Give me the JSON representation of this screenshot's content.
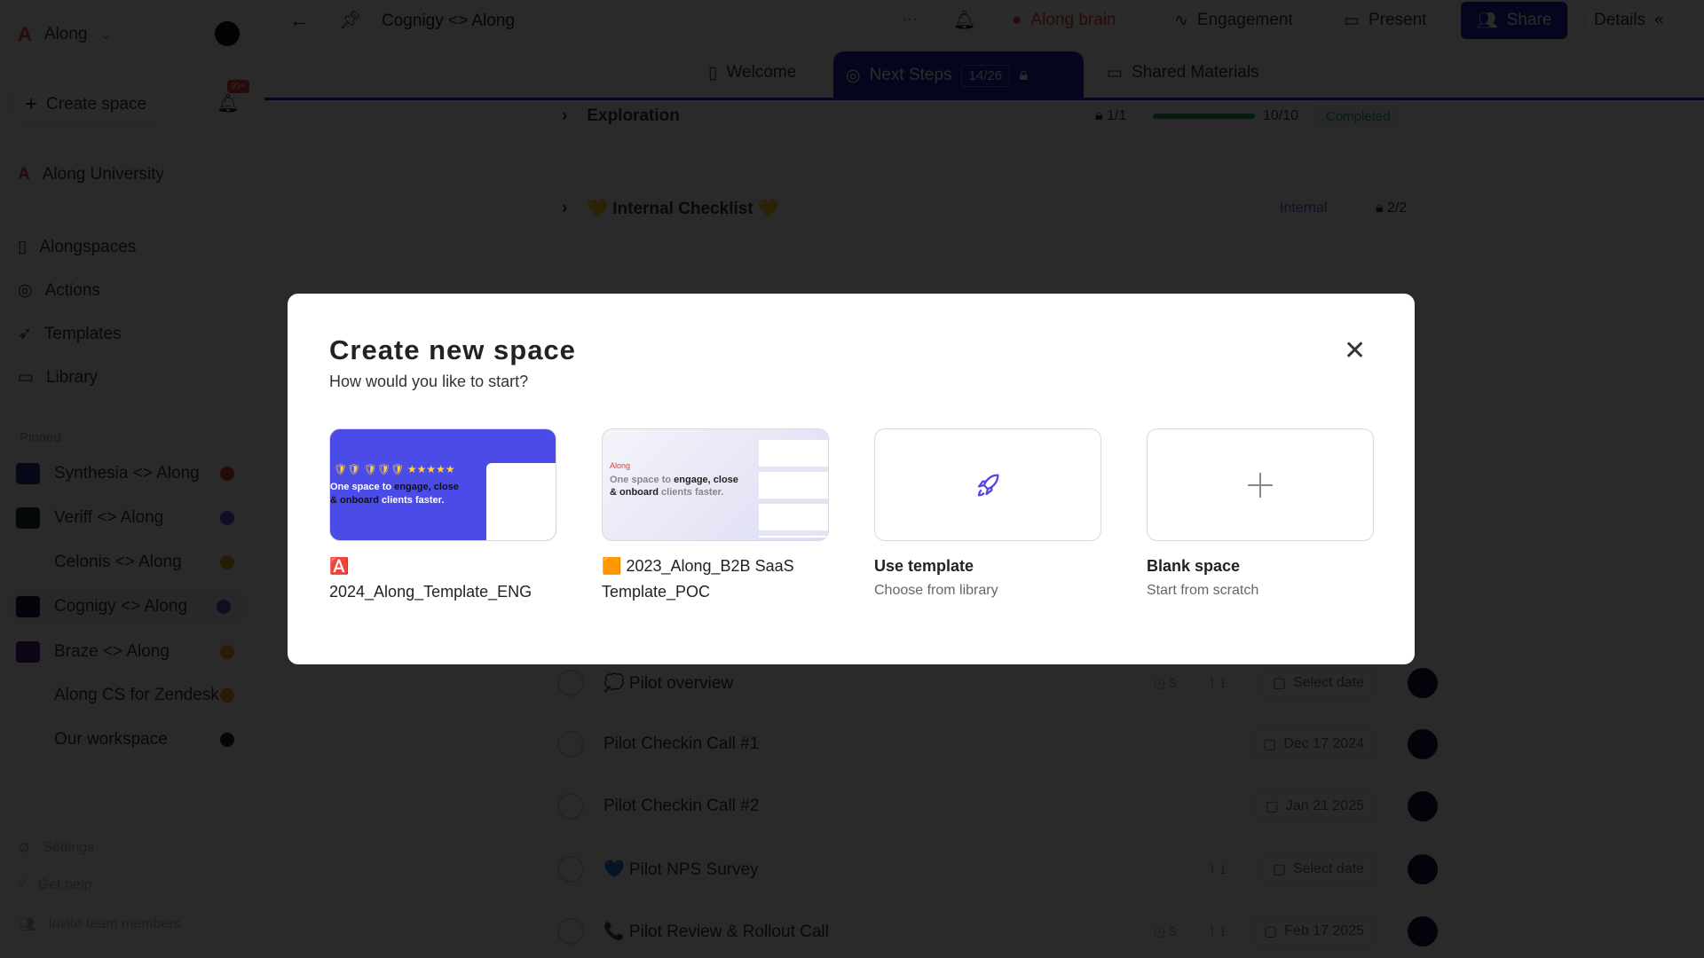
{
  "workspace": {
    "name": "Along"
  },
  "sidebar": {
    "create_space": "Create space",
    "notif_badge": "99+",
    "university": "Along University",
    "nav": [
      {
        "label": "Alongspaces",
        "icon": "file-icon"
      },
      {
        "label": "Actions",
        "icon": "check-circle-icon"
      },
      {
        "label": "Templates",
        "icon": "rocket-icon"
      },
      {
        "label": "Library",
        "icon": "folder-icon"
      }
    ],
    "pinned_label": "Pinned",
    "pinned": [
      {
        "label": "Synthesia <> Along",
        "logo": "#2a2f8f",
        "dot": "#e0403a"
      },
      {
        "label": "Veriff <> Along",
        "logo": "#0d3b2a",
        "dot": "#5b5bd6"
      },
      {
        "label": "Celonis <> Along",
        "logo": "#ffffff",
        "dot": "#e3a21a"
      },
      {
        "label": "Cognigy <> Along",
        "logo": "#0b1342",
        "dot": "#5b5bd6"
      },
      {
        "label": "Braze <> Along",
        "logo": "#4b1a7a",
        "dot": "#e3a21a"
      },
      {
        "label": "Along CS for Zendesk",
        "logo": "#ffffff",
        "dot": "#e3a21a"
      },
      {
        "label": "Our workspace",
        "logo": "#ffffff",
        "dot": "#222222"
      }
    ],
    "footer": [
      "Settings",
      "Get help",
      "Invite team members"
    ]
  },
  "topbar": {
    "title": "Cognigy <> Along",
    "along_brain": "Along brain",
    "engagement": "Engagement",
    "present": "Present",
    "share": "Share",
    "details": "Details"
  },
  "tabs": [
    {
      "label": "Welcome"
    },
    {
      "label": "Next Steps",
      "count": "14/26"
    },
    {
      "label": "Shared Materials"
    }
  ],
  "sections": [
    {
      "title": "Exploration",
      "lock": "1/1",
      "progress": "10/10",
      "progress_fraction": 1.0,
      "status": "Completed"
    },
    {
      "title": "💛 Internal Checklist 💛",
      "tag": "Internal",
      "lock": "2/2"
    }
  ],
  "tasks": [
    {
      "title": "💭 Pilot overview",
      "comments": "3",
      "attachments": "1",
      "date": "Select date"
    },
    {
      "title": "Pilot Checkin Call #1",
      "date": "Dec 17 2024"
    },
    {
      "title": "Pilot Checkin Call #2",
      "date": "Jan 21 2025"
    },
    {
      "title": "💙 Pilot NPS Survey",
      "attachments": "1",
      "date": "Select date"
    },
    {
      "title": "📞 Pilot Review & Rollout Call",
      "comments": "3",
      "attachments": "1",
      "date": "Feb 17 2025"
    }
  ],
  "modal": {
    "title": "Create new space",
    "subtitle": "How would you like to start?",
    "preview_text_a": "One space to ",
    "preview_text_b": "engage, close & onboard",
    "preview_text_c": " clients faster.",
    "preview_brand": "Along",
    "options": [
      {
        "emoji": "🅰️",
        "label": "2024_Along_Template_ENG"
      },
      {
        "emoji": "🟧",
        "label": "2023_Along_B2B SaaS Template_POC"
      },
      {
        "label": "Use template",
        "sub": "Choose from library"
      },
      {
        "label": "Blank space",
        "sub": "Start from scratch"
      }
    ],
    "accent": "#4f46e5"
  }
}
